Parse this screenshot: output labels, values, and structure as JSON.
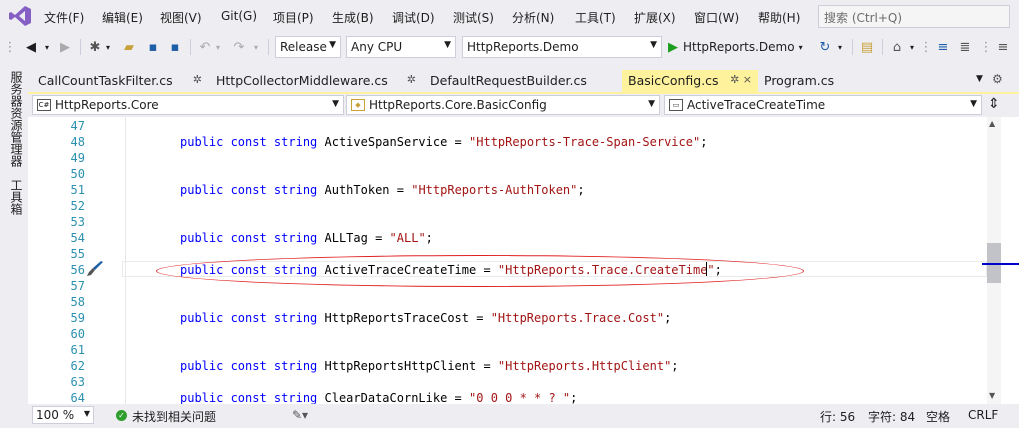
{
  "menu": [
    "文件(F)",
    "编辑(E)",
    "视图(V)",
    "Git(G)",
    "项目(P)",
    "生成(B)",
    "调试(D)",
    "测试(S)",
    "分析(N)",
    "工具(T)",
    "扩展(X)",
    "窗口(W)",
    "帮助(H)"
  ],
  "search_placeholder": "搜索 (Ctrl+Q)",
  "toolbar": {
    "configuration": "Release",
    "platform": "Any CPU",
    "startup_project": "HttpReports.Demo",
    "run_label": "HttpReports.Demo"
  },
  "side_tabs": [
    "服务器资源管理器",
    "工具箱"
  ],
  "tabs": [
    {
      "label": "CallCountTaskFilter.cs",
      "pin": "✲"
    },
    {
      "label": "HttpCollectorMiddleware.cs",
      "pin": "✲"
    },
    {
      "label": "DefaultRequestBuilder.cs",
      "pin": ""
    },
    {
      "label": "BasicConfig.cs",
      "pin": "✲ ×"
    },
    {
      "label": "Program.cs",
      "pin": ""
    }
  ],
  "nav": {
    "project": "HttpReports.Core",
    "class": "HttpReports.Core.BasicConfig",
    "member": "ActiveTraceCreateTime"
  },
  "code_lines": [
    {
      "num": "47",
      "name": "",
      "value": ""
    },
    {
      "num": "48",
      "name": "ActiveSpanService",
      "value": "\"HttpReports-Trace-Span-Service\""
    },
    {
      "num": "49",
      "name": "",
      "value": ""
    },
    {
      "num": "50",
      "name": "",
      "value": ""
    },
    {
      "num": "51",
      "name": "AuthToken",
      "value": "\"HttpReports-AuthToken\""
    },
    {
      "num": "52",
      "name": "",
      "value": ""
    },
    {
      "num": "53",
      "name": "",
      "value": ""
    },
    {
      "num": "54",
      "name": "ALLTag",
      "value": "\"ALL\""
    },
    {
      "num": "55",
      "name": "",
      "value": ""
    },
    {
      "num": "56",
      "name": "ActiveTraceCreateTime",
      "value": "\"HttpReports.Trace.CreateTime\""
    },
    {
      "num": "57",
      "name": "",
      "value": ""
    },
    {
      "num": "58",
      "name": "",
      "value": ""
    },
    {
      "num": "59",
      "name": "HttpReportsTraceCost",
      "value": "\"HttpReports.Trace.Cost\""
    },
    {
      "num": "60",
      "name": "",
      "value": ""
    },
    {
      "num": "61",
      "name": "",
      "value": ""
    },
    {
      "num": "62",
      "name": "HttpReportsHttpClient",
      "value": "\"HttpReports.HttpClient\""
    },
    {
      "num": "63",
      "name": "",
      "value": ""
    },
    {
      "num": "64",
      "name": "ClearDataCornLike",
      "value": "\"0 0 0 * * ? \""
    }
  ],
  "code_prefix": "public const string ",
  "status": {
    "zoom": "100 %",
    "issues": "未找到相关问题",
    "line": "行: 56",
    "col": "字符: 84",
    "indent": "空格",
    "eol": "CRLF"
  },
  "colors": {
    "keyword": "#0000FF",
    "string": "#A31515",
    "line_number": "#2B91AF",
    "active_tab": "#FFF29D",
    "annotation": "#E02020"
  }
}
